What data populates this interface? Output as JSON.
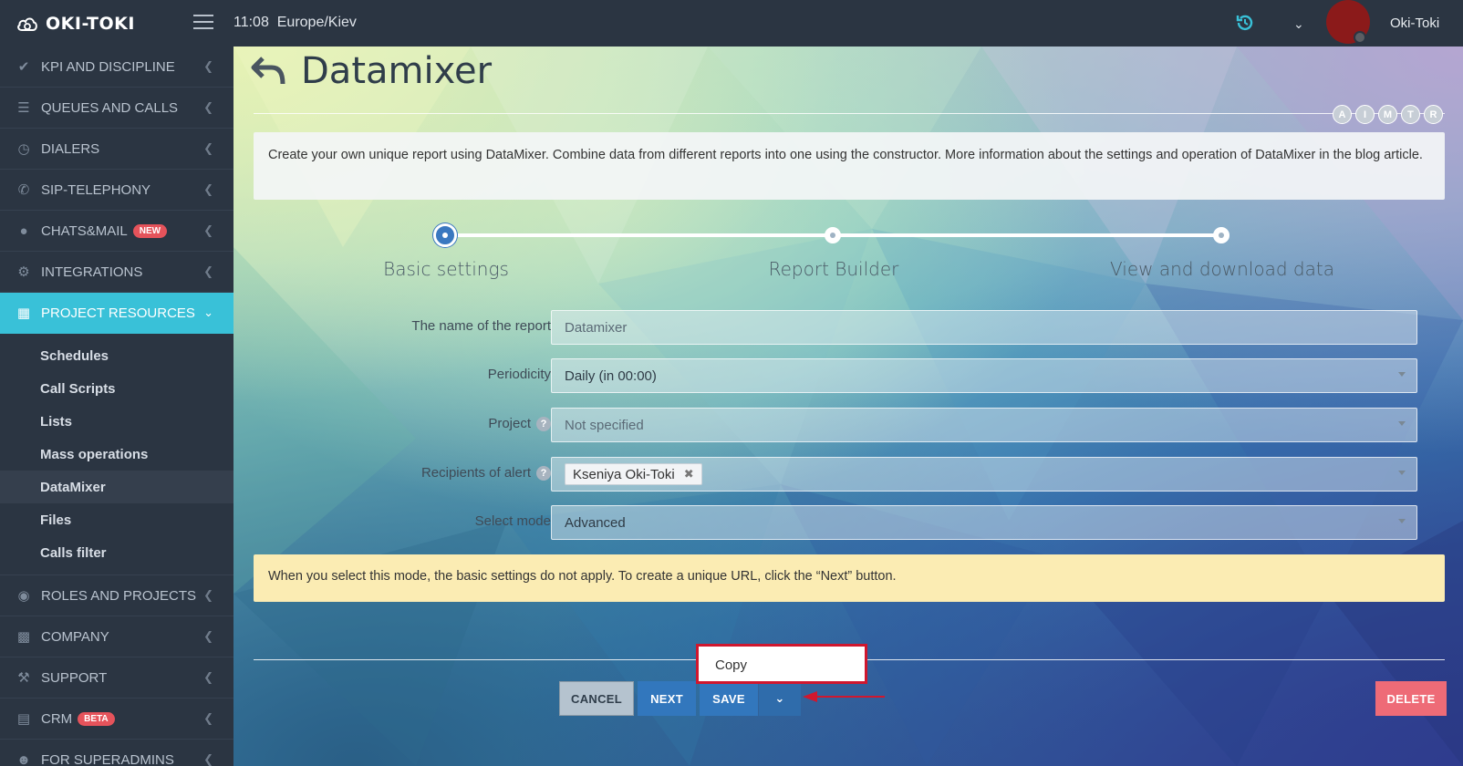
{
  "topbar": {
    "logo": "OKI-TOKI",
    "time": "11:08",
    "timezone": "Europe/Kiev",
    "username": "Oki-Toki",
    "icons": [
      "menu-icon",
      "history-icon",
      "chevron-down-icon"
    ]
  },
  "sidebar": {
    "items": [
      {
        "label": "KPI AND DISCIPLINE",
        "icon": "check-icon"
      },
      {
        "label": "QUEUES AND CALLS",
        "icon": "list-icon"
      },
      {
        "label": "DIALERS",
        "icon": "clock-icon"
      },
      {
        "label": "SIP-TELEPHONY",
        "icon": "phone-icon"
      },
      {
        "label": "CHATS&MAIL",
        "icon": "chat-icon",
        "badge": "NEW"
      },
      {
        "label": "INTEGRATIONS",
        "icon": "gears-icon"
      },
      {
        "label": "PROJECT RESOURCES",
        "icon": "grid-icon",
        "active": true
      },
      {
        "label": "ROLES AND PROJECTS",
        "icon": "toggle-icon"
      },
      {
        "label": "COMPANY",
        "icon": "bar-chart-icon"
      },
      {
        "label": "SUPPORT",
        "icon": "wrench-icon"
      },
      {
        "label": "CRM",
        "icon": "table-icon",
        "badge": "BETA"
      },
      {
        "label": "FOR SUPERADMINS",
        "icon": "user-icon"
      }
    ],
    "subitems": [
      {
        "label": "Schedules"
      },
      {
        "label": "Call Scripts"
      },
      {
        "label": "Lists"
      },
      {
        "label": "Mass operations"
      },
      {
        "label": "DataMixer",
        "current": true
      },
      {
        "label": "Files"
      },
      {
        "label": "Calls filter"
      }
    ]
  },
  "page": {
    "title": "Datamixer",
    "badges": [
      "A",
      "I",
      "M",
      "T",
      "R"
    ],
    "info": "Create your own unique report using DataMixer. Combine data from different reports into one using the constructor. More information about the settings and operation of DataMixer in the blog article.",
    "steps": [
      "Basic settings",
      "Report Builder",
      "View and download data"
    ],
    "active_step": 0
  },
  "form": {
    "report_name": {
      "label": "The name of the report",
      "value": "Datamixer"
    },
    "periodicity": {
      "label": "Periodicity",
      "value": "Daily (in 00:00)"
    },
    "project": {
      "label": "Project",
      "value": "Not specified"
    },
    "recipients": {
      "label": "Recipients of alert",
      "tag": "Kseniya Oki-Toki"
    },
    "mode": {
      "label": "Select mode",
      "value": "Advanced"
    }
  },
  "warning": "When you select this mode, the basic settings do not apply. To create a unique URL, click the “Next” button.",
  "buttons": {
    "cancel": "CANCEL",
    "next": "NEXT",
    "save": "SAVE",
    "delete": "DELETE",
    "copy": "Copy"
  },
  "colors": {
    "accent": "#39c1d8",
    "primary": "#3277bd",
    "danger": "#ee6b77",
    "highlight": "#d0172e"
  }
}
